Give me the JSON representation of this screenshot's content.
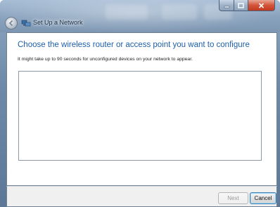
{
  "window": {
    "title": "Set Up a Network",
    "caption_buttons": {
      "minimize": "minimize-icon",
      "maximize": "maximize-icon",
      "close": "close-icon"
    },
    "back_icon": "back-arrow-icon"
  },
  "main": {
    "heading": "Choose the wireless router or access point you want to configure",
    "description": "It might take up to 90 seconds for unconfigured devices on your network to appear.",
    "device_list": []
  },
  "footer": {
    "next_label": "Next",
    "cancel_label": "Cancel"
  },
  "colors": {
    "heading": "#1e5fa8",
    "close_button": "#d2543a"
  }
}
